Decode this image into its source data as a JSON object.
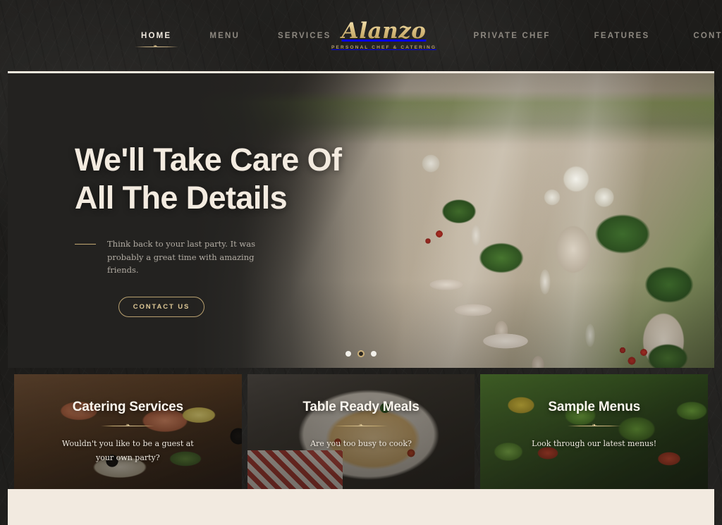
{
  "site": {
    "logo_name": "Alanzo",
    "logo_tagline": "Personal Chef & Catering"
  },
  "nav": {
    "left_items": [
      {
        "label": "HOME",
        "active": true
      },
      {
        "label": "MENU",
        "active": false
      },
      {
        "label": "SERVICES",
        "active": false
      }
    ],
    "right_items": [
      {
        "label": "PRIVATE CHEF",
        "active": false
      },
      {
        "label": "FEATURES",
        "active": false
      },
      {
        "label": "CONTACT US",
        "active": false
      }
    ],
    "active_ornament": "❧"
  },
  "hero": {
    "title_line_1": "We'll Take Care Of",
    "title_line_2": "All The Details",
    "subtitle": "Think back to your last party. It was probably a great time with amazing friends.",
    "cta_label": "CONTACT US",
    "slider_dots": [
      {
        "active": false
      },
      {
        "active": true
      },
      {
        "active": false
      }
    ]
  },
  "cards": [
    {
      "title": "Catering Services",
      "text": "Wouldn't you like to be a guest at your own party?",
      "divider_glyph": "❧"
    },
    {
      "title": "Table Ready Meals",
      "text": "Are you too busy to cook?",
      "divider_glyph": "❧"
    },
    {
      "title": "Sample Menus",
      "text": "Look through our latest menus!",
      "divider_glyph": "❧"
    }
  ],
  "colors": {
    "gold": "#c9ab6e",
    "cream": "#f2eae0",
    "dark": "#232220",
    "muted_nav": "#8d8880"
  }
}
